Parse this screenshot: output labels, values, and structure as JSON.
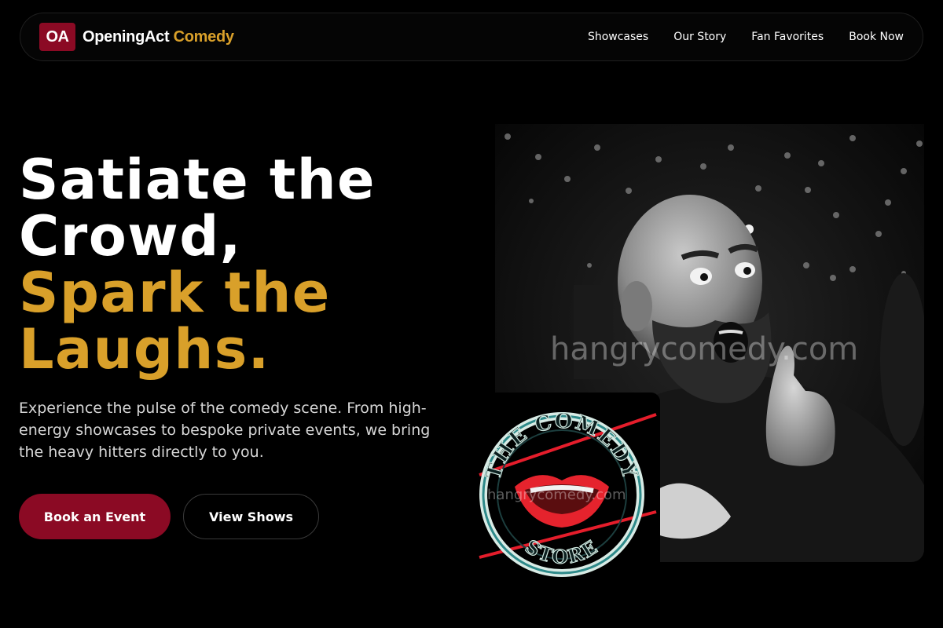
{
  "nav": {
    "logo_mark": "OA",
    "brand_main": "OpeningAct",
    "brand_accent": "Comedy",
    "links": [
      "Showcases",
      "Our Story",
      "Fan Favorites",
      "Book Now"
    ]
  },
  "hero": {
    "headline_line1": "Satiate the",
    "headline_line2": "Crowd,",
    "headline_line3": "Spark the",
    "headline_line4": "Laughs.",
    "lede": "Experience the pulse of the comedy scene. From high-energy showcases to bespoke private events, we bring the heavy hitters directly to you.",
    "primary_cta": "Book an Event",
    "secondary_cta": "View Shows"
  },
  "media": {
    "photo_watermark": "hangrycomedy.com",
    "sign_watermark": "hangrycomedy.com",
    "sign_text_top": "THE COMEDY",
    "sign_text_bottom": "STORE"
  },
  "colors": {
    "brand_red": "#8b0a24",
    "accent_gold": "#d9a02a",
    "background": "#000000"
  }
}
